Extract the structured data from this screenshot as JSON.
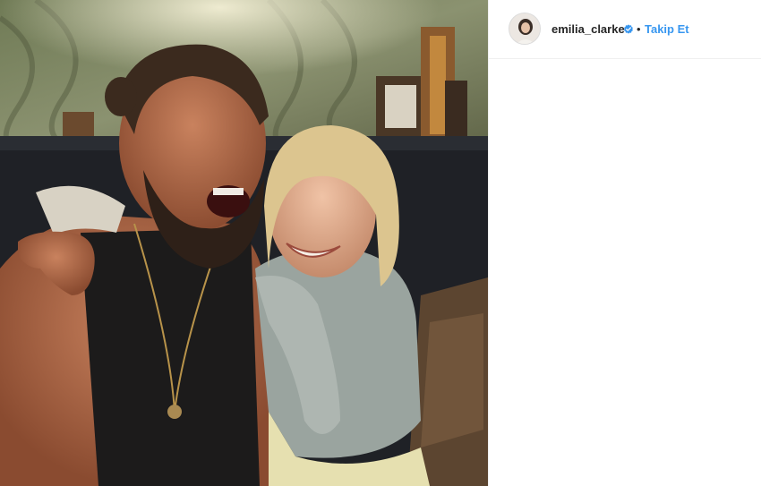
{
  "post": {
    "image_alt": "Instagram photo",
    "username": "emilia_clarke",
    "verified": true,
    "separator": "•",
    "follow_label": "Takip Et"
  },
  "colors": {
    "link": "#3897f0",
    "text": "#262626",
    "border": "#efefef"
  }
}
